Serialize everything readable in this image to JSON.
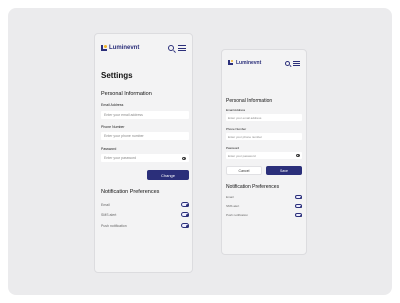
{
  "colors": {
    "brand": "#2b2f7a",
    "background": "#ebebed",
    "screen": "#f3f3f4"
  },
  "brand": {
    "name": "Luminevnt",
    "logo_icon": "luminevnt-logo-icon"
  },
  "screen_a": {
    "title": "Settings",
    "personal_info_heading": "Personal Information",
    "email_label": "Email Address",
    "email_placeholder": "Enter your email address",
    "phone_label": "Phone Number",
    "phone_placeholder": "Enter your phone number",
    "password_label": "Password",
    "password_placeholder": "Enter your password",
    "change_button": "Change",
    "notifications_heading": "Notification Preferences",
    "notifications": [
      {
        "label": "Email",
        "enabled": true
      },
      {
        "label": "SMS alert",
        "enabled": true
      },
      {
        "label": "Push notification",
        "enabled": true
      }
    ]
  },
  "screen_b": {
    "personal_info_heading": "Personal Information",
    "email_label": "Email Address",
    "email_placeholder": "Enter your email address",
    "phone_label": "Phone Number",
    "phone_placeholder": "Enter your phone number",
    "password_label": "Password",
    "password_placeholder": "Enter your password",
    "cancel_button": "Cancel",
    "save_button": "Save",
    "notifications_heading": "Notification Preferences",
    "notifications": [
      {
        "label": "Email",
        "enabled": true
      },
      {
        "label": "SMS alert",
        "enabled": true
      },
      {
        "label": "Push notification",
        "enabled": true
      }
    ]
  }
}
